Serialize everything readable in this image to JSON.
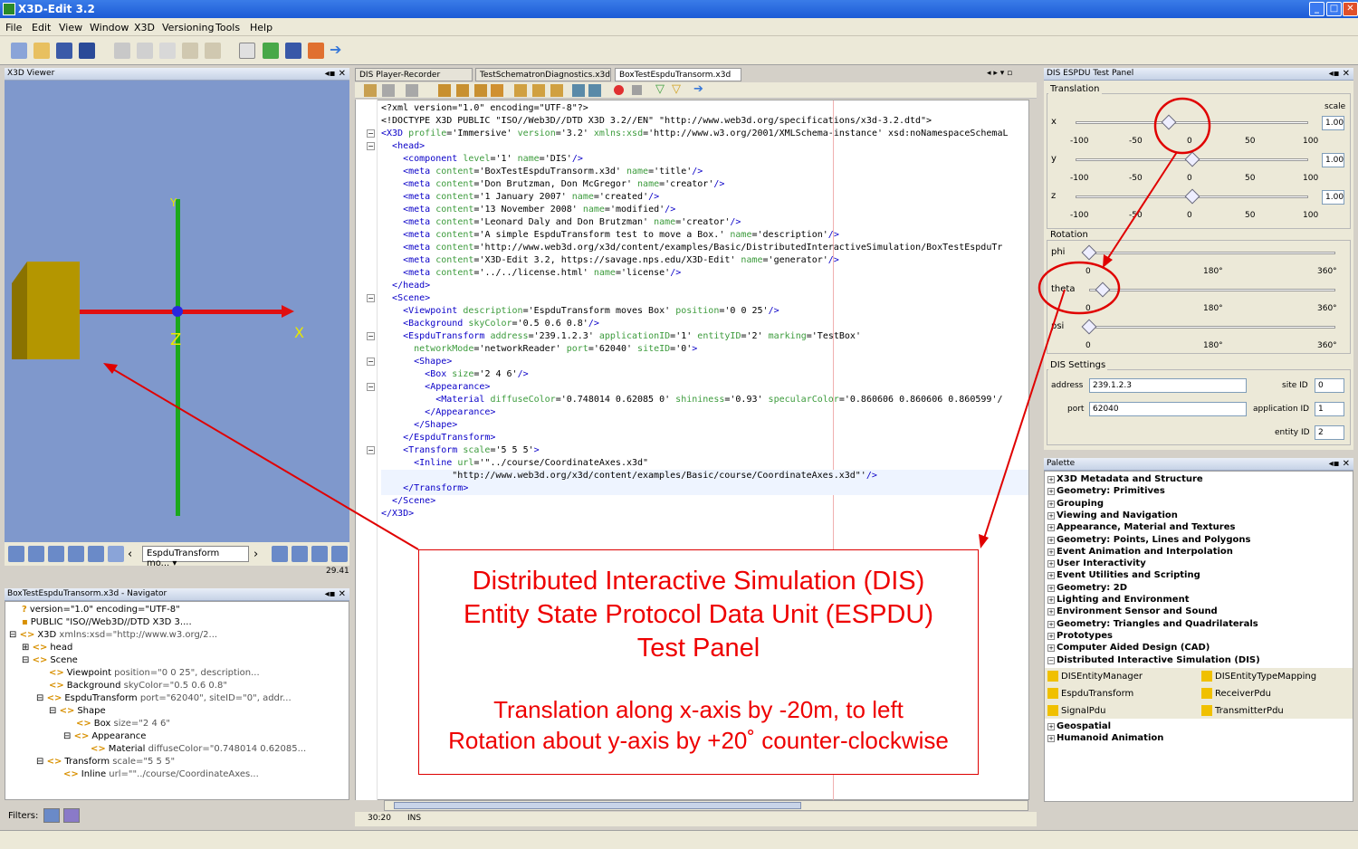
{
  "window": {
    "title": "X3D-Edit 3.2"
  },
  "menu": [
    "File",
    "Edit",
    "View",
    "Window",
    "X3D",
    "Versioning",
    "Tools",
    "Help"
  ],
  "viewer": {
    "title": "X3D Viewer",
    "axis_x": "X",
    "axis_y": "Y",
    "axis_z": "Z",
    "viewpoint": "EspduTransform mo...",
    "fps": "29.41"
  },
  "navigator": {
    "title": "BoxTestEspduTransorm.x3d - Navigator",
    "filters_label": "Filters:",
    "rows": [
      {
        "name": "version=\"1.0\" encoding=\"UTF-8\"",
        "attr": ""
      },
      {
        "name": "PUBLIC \"ISO//Web3D//DTD X3D 3....",
        "attr": ""
      },
      {
        "name": "X3D",
        "attr": " xmlns:xsd=\"http://www.w3.org/2..."
      },
      {
        "name": "head",
        "attr": ""
      },
      {
        "name": "Scene",
        "attr": ""
      },
      {
        "name": "Viewpoint",
        "attr": " position=\"0 0 25\", description..."
      },
      {
        "name": "Background",
        "attr": " skyColor=\"0.5 0.6 0.8\""
      },
      {
        "name": "EspduTransform",
        "attr": " port=\"62040\", siteID=\"0\", addr..."
      },
      {
        "name": "Shape",
        "attr": ""
      },
      {
        "name": "Box",
        "attr": " size=\"2 4 6\""
      },
      {
        "name": "Appearance",
        "attr": ""
      },
      {
        "name": "Material",
        "attr": " diffuseColor=\"0.748014 0.62085..."
      },
      {
        "name": "Transform",
        "attr": " scale=\"5 5 5\""
      },
      {
        "name": "Inline",
        "attr": " url=\"\"../course/CoordinateAxes..."
      }
    ]
  },
  "tabs": [
    "DIS Player-Recorder Window",
    "TestSchematronDiagnostics.x3d",
    "BoxTestEspduTransorm.x3d *"
  ],
  "code_lines": [
    "<?xml version=\"1.0\" encoding=\"UTF-8\"?>",
    "<!DOCTYPE X3D PUBLIC \"ISO//Web3D//DTD X3D 3.2//EN\" \"http://www.web3d.org/specifications/x3d-3.2.dtd\">",
    "<X3D profile='Immersive' version='3.2' xmlns:xsd='http://www.w3.org/2001/XMLSchema-instance' xsd:noNamespaceSchemaL",
    "  <head>",
    "    <component level='1' name='DIS'/>",
    "    <meta content='BoxTestEspduTransorm.x3d' name='title'/>",
    "    <meta content='Don Brutzman, Don McGregor' name='creator'/>",
    "    <meta content='1 January 2007' name='created'/>",
    "    <meta content='13 November 2008' name='modified'/>",
    "    <meta content='Leonard Daly and Don Brutzman' name='creator'/>",
    "    <meta content='A simple EspduTransform test to move a Box.' name='description'/>",
    "    <meta content='http://www.web3d.org/x3d/content/examples/Basic/DistributedInteractiveSimulation/BoxTestEspduTr",
    "    <meta content='X3D-Edit 3.2, https://savage.nps.edu/X3D-Edit' name='generator'/>",
    "    <meta content='../../license.html' name='license'/>",
    "  </head>",
    "  <Scene>",
    "    <Viewpoint description='EspduTransform moves Box' position='0 0 25'/>",
    "    <Background skyColor='0.5 0.6 0.8'/>",
    "    <EspduTransform address='239.1.2.3' applicationID='1' entityID='2' marking='TestBox'",
    "      networkMode='networkReader' port='62040' siteID='0'>",
    "      <Shape>",
    "        <Box size='2 4 6'/>",
    "        <Appearance>",
    "          <Material diffuseColor='0.748014 0.62085 0' shininess='0.93' specularColor='0.860606 0.860606 0.860599'/",
    "        </Appearance>",
    "      </Shape>",
    "    </EspduTransform>",
    "    <Transform scale='5 5 5'>",
    "      <Inline url='\"../course/CoordinateAxes.x3d\"",
    "             \"http://www.web3d.org/x3d/content/examples/Basic/course/CoordinateAxes.x3d\"'/>",
    "    </Transform>",
    "  </Scene>",
    "</X3D>"
  ],
  "status": {
    "position": "30:20",
    "mode": "INS"
  },
  "dis_panel": {
    "title": "DIS ESPDU Test Panel",
    "translation_label": "Translation",
    "scale_label": "scale",
    "sliders": [
      {
        "axis": "x",
        "scale": "1.00",
        "value": -20
      },
      {
        "axis": "y",
        "scale": "1.00",
        "value": 0
      },
      {
        "axis": "z",
        "scale": "1.00",
        "value": 0
      }
    ],
    "trans_ticks": [
      "-100",
      "-50",
      "0",
      "50",
      "100"
    ],
    "rotation_label": "Rotation",
    "rotations": [
      {
        "axis": "phi",
        "value": 0
      },
      {
        "axis": "theta",
        "value": 20
      },
      {
        "axis": "psi",
        "value": 0
      }
    ],
    "rot_ticks": [
      "0",
      "180°",
      "360°"
    ],
    "settings_label": "DIS Settings",
    "address_label": "address",
    "address": "239.1.2.3",
    "port_label": "port",
    "port": "62040",
    "site_label": "site ID",
    "site": "0",
    "app_label": "application ID",
    "app": "1",
    "entity_label": "entity ID",
    "entity": "2"
  },
  "palette": {
    "title": "Palette",
    "groups": [
      "X3D Metadata and Structure",
      "Geometry: Primitives",
      "Grouping",
      "Viewing and Navigation",
      "Appearance, Material and Textures",
      "Geometry: Points, Lines and Polygons",
      "Event Animation and Interpolation",
      "User Interactivity",
      "Event Utilities and Scripting",
      "Geometry: 2D",
      "Lighting and Environment",
      "Environment Sensor and Sound",
      "Geometry: Triangles and Quadrilaterals",
      "Prototypes",
      "Computer Aided Design (CAD)",
      "Distributed Interactive Simulation (DIS)"
    ],
    "dis_items": [
      "DISEntityManager",
      "DISEntityTypeMapping",
      "EspduTransform",
      "ReceiverPdu",
      "SignalPdu",
      "TransmitterPdu"
    ],
    "after_groups": [
      "Geospatial",
      "Humanoid Animation"
    ]
  },
  "annotation": {
    "line1": "Distributed Interactive Simulation (DIS)",
    "line2": "Entity State Protocol Data Unit (ESPDU)",
    "line3": "Test Panel",
    "line4": "Translation along x-axis by -20m, to left",
    "line5": "Rotation about y-axis by +20˚ counter-clockwise"
  }
}
